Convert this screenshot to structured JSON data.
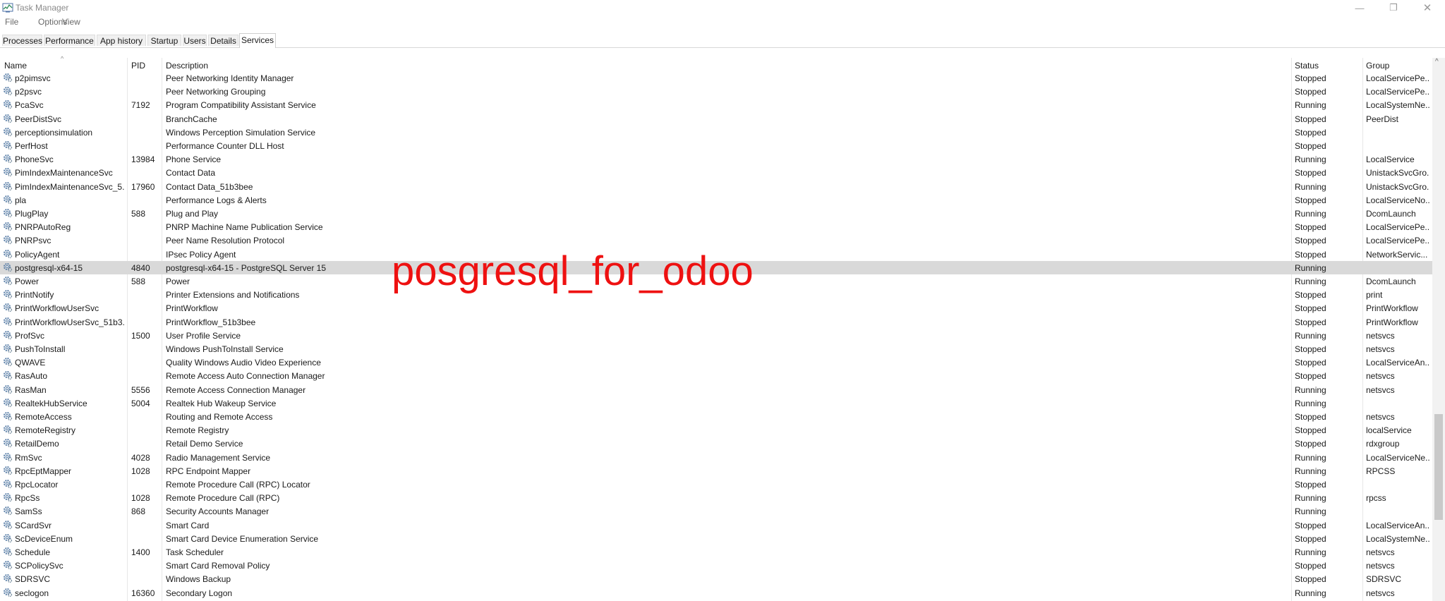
{
  "window": {
    "title": "Task Manager",
    "controls": {
      "minimize": "—",
      "maximize": "❐",
      "close": "✕"
    }
  },
  "menu": {
    "file": "File",
    "options": "Options",
    "view": "View"
  },
  "tabs": [
    {
      "label": "Processes"
    },
    {
      "label": "Performance"
    },
    {
      "label": "App history"
    },
    {
      "label": "Startup"
    },
    {
      "label": "Users"
    },
    {
      "label": "Details"
    },
    {
      "label": "Services"
    }
  ],
  "active_tab": "Services",
  "columns": {
    "name": "Name",
    "pid": "PID",
    "description": "Description",
    "status": "Status",
    "group": "Group"
  },
  "sort_indicator": "^",
  "rows": [
    {
      "name": "p2pimsvc",
      "pid": "",
      "description": "Peer Networking Identity Manager",
      "status": "Stopped",
      "group": "LocalServicePe..."
    },
    {
      "name": "p2psvc",
      "pid": "",
      "description": "Peer Networking Grouping",
      "status": "Stopped",
      "group": "LocalServicePe..."
    },
    {
      "name": "PcaSvc",
      "pid": "7192",
      "description": "Program Compatibility Assistant Service",
      "status": "Running",
      "group": "LocalSystemNe..."
    },
    {
      "name": "PeerDistSvc",
      "pid": "",
      "description": "BranchCache",
      "status": "Stopped",
      "group": "PeerDist"
    },
    {
      "name": "perceptionsimulation",
      "pid": "",
      "description": "Windows Perception Simulation Service",
      "status": "Stopped",
      "group": ""
    },
    {
      "name": "PerfHost",
      "pid": "",
      "description": "Performance Counter DLL Host",
      "status": "Stopped",
      "group": ""
    },
    {
      "name": "PhoneSvc",
      "pid": "13984",
      "description": "Phone Service",
      "status": "Running",
      "group": "LocalService"
    },
    {
      "name": "PimIndexMaintenanceSvc",
      "pid": "",
      "description": "Contact Data",
      "status": "Stopped",
      "group": "UnistackSvcGro..."
    },
    {
      "name": "PimIndexMaintenanceSvc_5...",
      "pid": "17960",
      "description": "Contact Data_51b3bee",
      "status": "Running",
      "group": "UnistackSvcGro..."
    },
    {
      "name": "pla",
      "pid": "",
      "description": "Performance Logs & Alerts",
      "status": "Stopped",
      "group": "LocalServiceNo..."
    },
    {
      "name": "PlugPlay",
      "pid": "588",
      "description": "Plug and Play",
      "status": "Running",
      "group": "DcomLaunch"
    },
    {
      "name": "PNRPAutoReg",
      "pid": "",
      "description": "PNRP Machine Name Publication Service",
      "status": "Stopped",
      "group": "LocalServicePe..."
    },
    {
      "name": "PNRPsvc",
      "pid": "",
      "description": "Peer Name Resolution Protocol",
      "status": "Stopped",
      "group": "LocalServicePe..."
    },
    {
      "name": "PolicyAgent",
      "pid": "",
      "description": "IPsec Policy Agent",
      "status": "Stopped",
      "group": "NetworkServic..."
    },
    {
      "name": "postgresql-x64-15",
      "pid": "4840",
      "description": "postgresql-x64-15 - PostgreSQL Server 15",
      "status": "Running",
      "group": "",
      "selected": true
    },
    {
      "name": "Power",
      "pid": "588",
      "description": "Power",
      "status": "Running",
      "group": "DcomLaunch"
    },
    {
      "name": "PrintNotify",
      "pid": "",
      "description": "Printer Extensions and Notifications",
      "status": "Stopped",
      "group": "print"
    },
    {
      "name": "PrintWorkflowUserSvc",
      "pid": "",
      "description": "PrintWorkflow",
      "status": "Stopped",
      "group": "PrintWorkflow"
    },
    {
      "name": "PrintWorkflowUserSvc_51b3...",
      "pid": "",
      "description": "PrintWorkflow_51b3bee",
      "status": "Stopped",
      "group": "PrintWorkflow"
    },
    {
      "name": "ProfSvc",
      "pid": "1500",
      "description": "User Profile Service",
      "status": "Running",
      "group": "netsvcs"
    },
    {
      "name": "PushToInstall",
      "pid": "",
      "description": "Windows PushToInstall Service",
      "status": "Stopped",
      "group": "netsvcs"
    },
    {
      "name": "QWAVE",
      "pid": "",
      "description": "Quality Windows Audio Video Experience",
      "status": "Stopped",
      "group": "LocalServiceAn..."
    },
    {
      "name": "RasAuto",
      "pid": "",
      "description": "Remote Access Auto Connection Manager",
      "status": "Stopped",
      "group": "netsvcs"
    },
    {
      "name": "RasMan",
      "pid": "5556",
      "description": "Remote Access Connection Manager",
      "status": "Running",
      "group": "netsvcs"
    },
    {
      "name": "RealtekHubService",
      "pid": "5004",
      "description": "Realtek Hub Wakeup Service",
      "status": "Running",
      "group": ""
    },
    {
      "name": "RemoteAccess",
      "pid": "",
      "description": "Routing and Remote Access",
      "status": "Stopped",
      "group": "netsvcs"
    },
    {
      "name": "RemoteRegistry",
      "pid": "",
      "description": "Remote Registry",
      "status": "Stopped",
      "group": "localService"
    },
    {
      "name": "RetailDemo",
      "pid": "",
      "description": "Retail Demo Service",
      "status": "Stopped",
      "group": "rdxgroup"
    },
    {
      "name": "RmSvc",
      "pid": "4028",
      "description": "Radio Management Service",
      "status": "Running",
      "group": "LocalServiceNe..."
    },
    {
      "name": "RpcEptMapper",
      "pid": "1028",
      "description": "RPC Endpoint Mapper",
      "status": "Running",
      "group": "RPCSS"
    },
    {
      "name": "RpcLocator",
      "pid": "",
      "description": "Remote Procedure Call (RPC) Locator",
      "status": "Stopped",
      "group": ""
    },
    {
      "name": "RpcSs",
      "pid": "1028",
      "description": "Remote Procedure Call (RPC)",
      "status": "Running",
      "group": "rpcss"
    },
    {
      "name": "SamSs",
      "pid": "868",
      "description": "Security Accounts Manager",
      "status": "Running",
      "group": ""
    },
    {
      "name": "SCardSvr",
      "pid": "",
      "description": "Smart Card",
      "status": "Stopped",
      "group": "LocalServiceAn..."
    },
    {
      "name": "ScDeviceEnum",
      "pid": "",
      "description": "Smart Card Device Enumeration Service",
      "status": "Stopped",
      "group": "LocalSystemNe..."
    },
    {
      "name": "Schedule",
      "pid": "1400",
      "description": "Task Scheduler",
      "status": "Running",
      "group": "netsvcs"
    },
    {
      "name": "SCPolicySvc",
      "pid": "",
      "description": "Smart Card Removal Policy",
      "status": "Stopped",
      "group": "netsvcs"
    },
    {
      "name": "SDRSVC",
      "pid": "",
      "description": "Windows Backup",
      "status": "Stopped",
      "group": "SDRSVC"
    },
    {
      "name": "seclogon",
      "pid": "16360",
      "description": "Secondary Logon",
      "status": "Running",
      "group": "netsvcs"
    }
  ],
  "overlay_text": "posgresql_for_odoo",
  "colors": {
    "overlay": "#ee1111",
    "selected_row": "#d9d9d9"
  },
  "row_icon": "gear-service-icon",
  "scroll_up_glyph": "^"
}
